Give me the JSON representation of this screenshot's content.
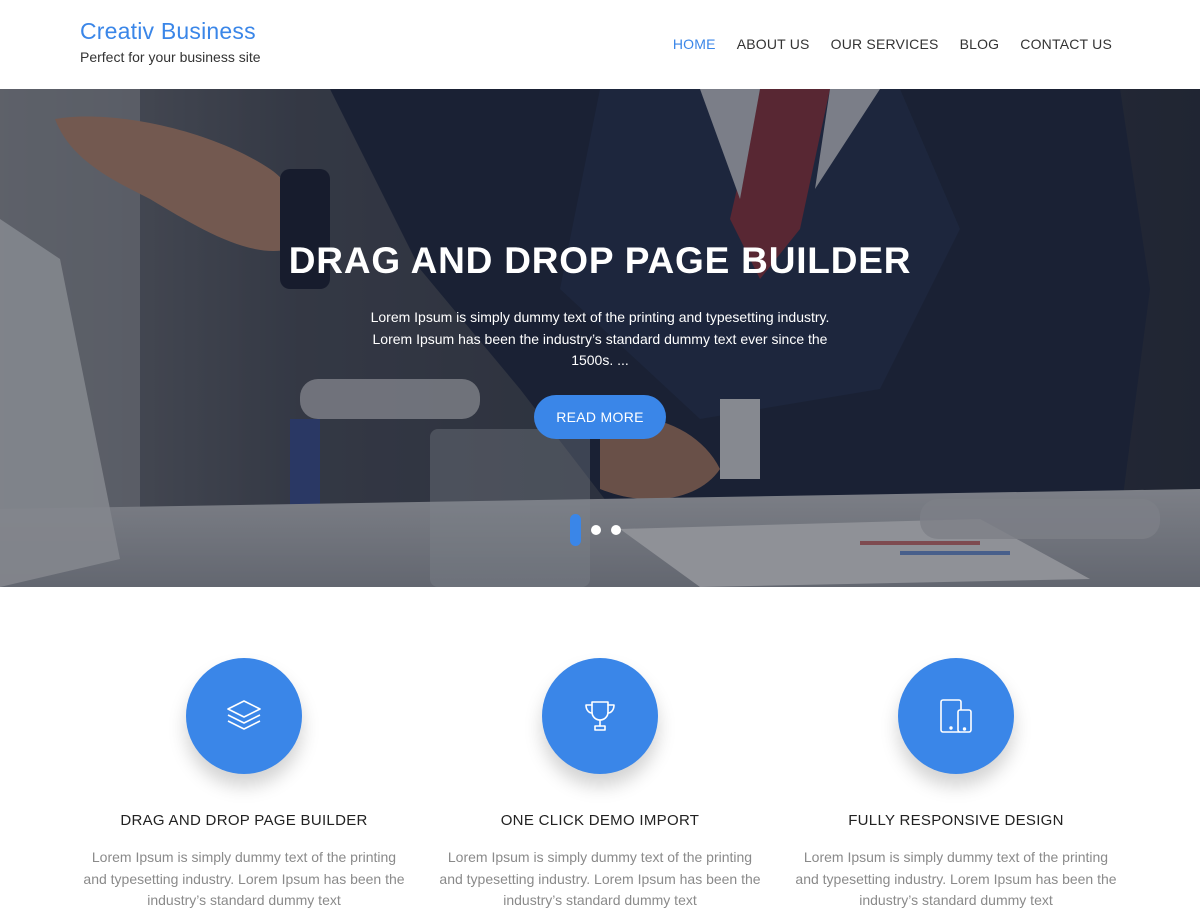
{
  "header": {
    "site_title": "Creativ Business",
    "tagline": "Perfect for your business site",
    "nav": [
      {
        "label": "HOME",
        "active": true
      },
      {
        "label": "ABOUT US",
        "active": false
      },
      {
        "label": "OUR SERVICES",
        "active": false
      },
      {
        "label": "BLOG",
        "active": false
      },
      {
        "label": "CONTACT US",
        "active": false
      }
    ]
  },
  "hero": {
    "title": "DRAG AND DROP PAGE BUILDER",
    "text": "Lorem Ipsum is simply dummy text of the printing and typesetting industry. Lorem Ipsum has been the industry’s standard dummy text ever since the 1500s. ...",
    "button": "READ MORE",
    "slides": 3,
    "active_slide": 1
  },
  "features": [
    {
      "icon": "layers-icon",
      "title": "DRAG AND DROP PAGE BUILDER",
      "text": "Lorem Ipsum is simply dummy text of the printing and typesetting industry. Lorem Ipsum has been the industry’s standard dummy text"
    },
    {
      "icon": "trophy-icon",
      "title": "ONE CLICK DEMO IMPORT",
      "text": "Lorem Ipsum is simply dummy text of the printing and typesetting industry. Lorem Ipsum has been the industry’s standard dummy text"
    },
    {
      "icon": "devices-icon",
      "title": "FULLY RESPONSIVE DESIGN",
      "text": "Lorem Ipsum is simply dummy text of the printing and typesetting industry. Lorem Ipsum has been the industry’s standard dummy text"
    }
  ],
  "colors": {
    "accent": "#3a86e8",
    "heading": "#222222",
    "body_text": "#8a8a8a"
  }
}
